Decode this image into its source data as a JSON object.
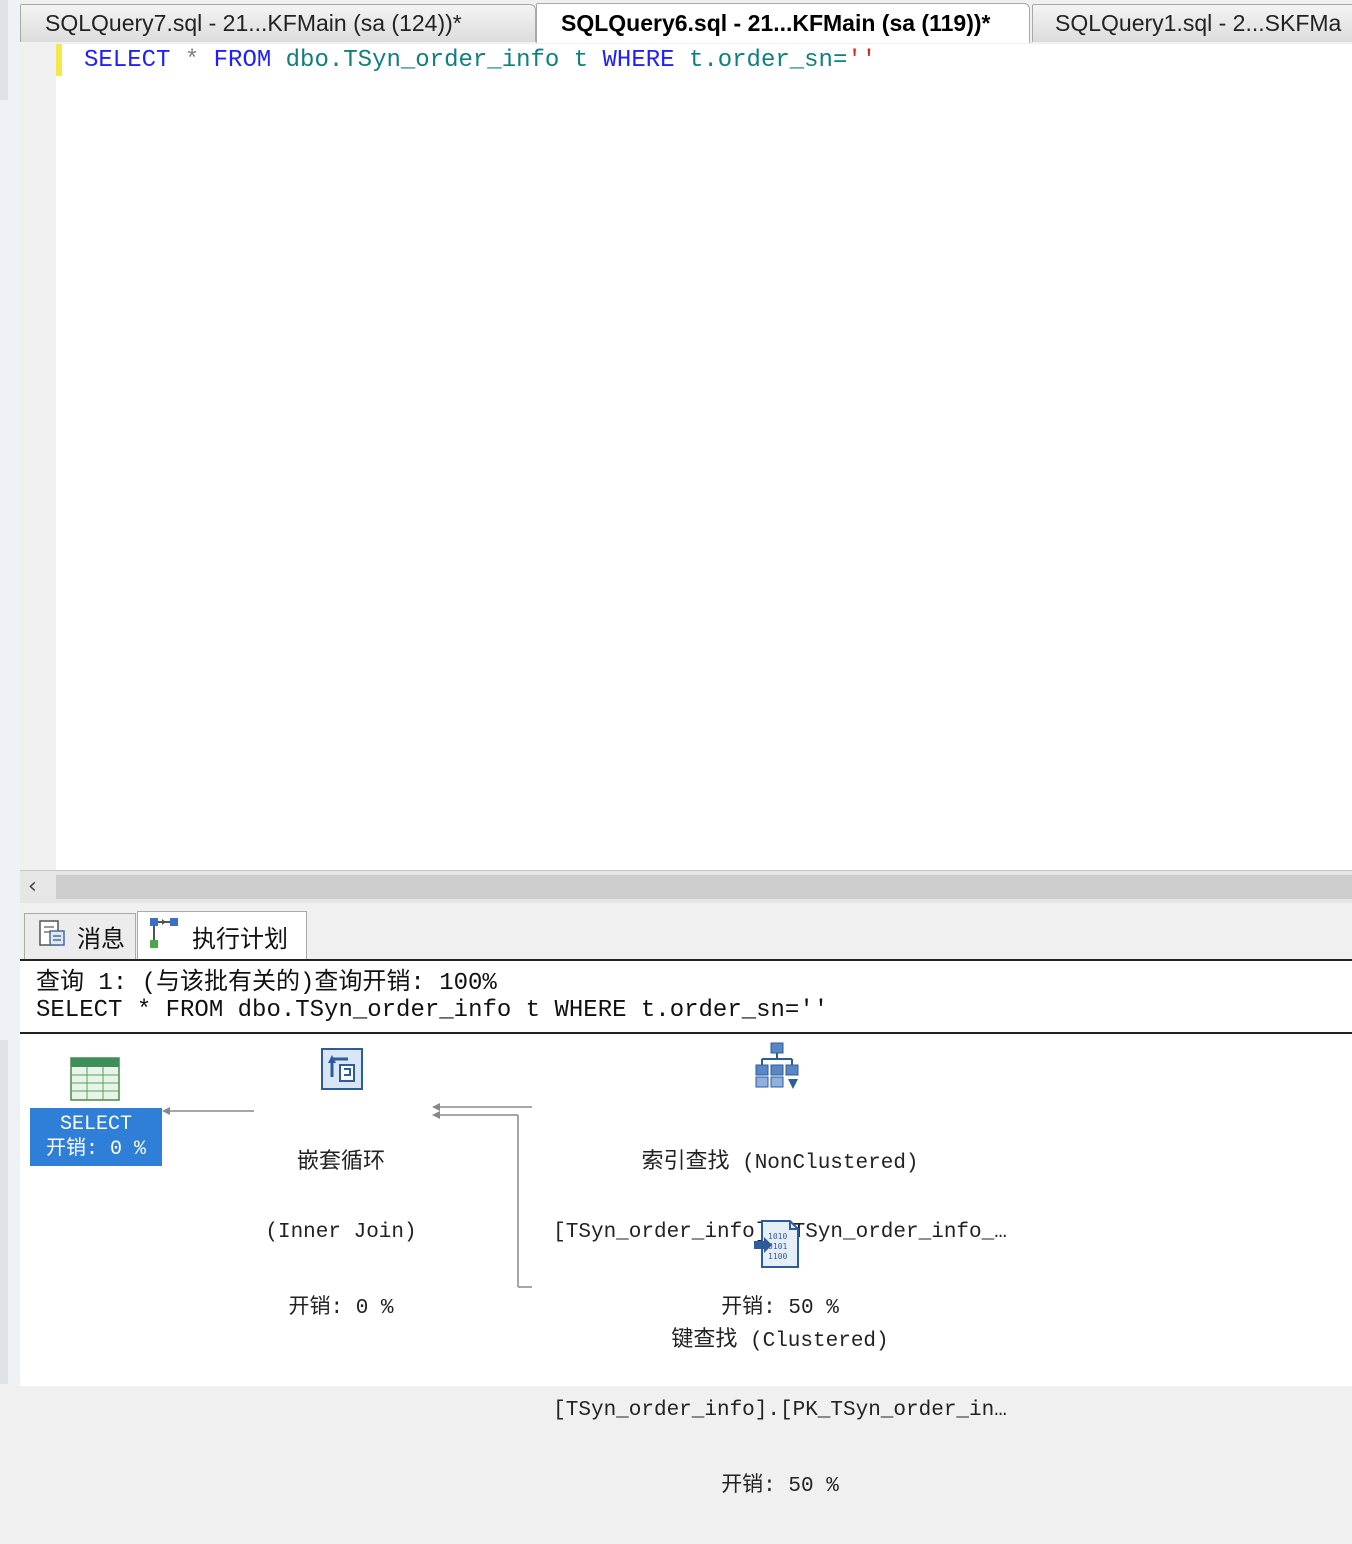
{
  "tabs": [
    {
      "label": "SQLQuery7.sql - 21...KFMain (sa (124))*",
      "active": false
    },
    {
      "label": "SQLQuery6.sql - 21...KFMain (sa (119))*",
      "active": true
    },
    {
      "label": "SQLQuery1.sql - 2...SKFMa",
      "active": false
    }
  ],
  "editor": {
    "code": {
      "select": "SELECT",
      "star": "*",
      "from": "FROM",
      "table": "dbo.TSyn_order_info t",
      "where": "WHERE",
      "column": "t.order_sn=",
      "literal": "''"
    }
  },
  "results_tabs": {
    "messages": "消息",
    "execution_plan": "执行计划"
  },
  "plan": {
    "header": "查询 1: (与该批有关的)查询开销: 100%",
    "query_text": "SELECT * FROM dbo.TSyn_order_info t WHERE t.order_sn=''",
    "nodes": {
      "select": {
        "title": "SELECT",
        "cost": "开销: 0 %"
      },
      "nested_loop": {
        "title": "嵌套循环",
        "subtitle": "(Inner Join)",
        "cost": "开销: 0 %"
      },
      "index_seek": {
        "title": "索引查找",
        "type": "(NonClustered)",
        "object": "[TSyn_order_info].[TSyn_order_info_…",
        "cost": "开销: 50 %"
      },
      "key_lookup": {
        "title": "键查找",
        "type": "(Clustered)",
        "object": "[TSyn_order_info].[PK_TSyn_order_in…",
        "cost": "开销: 50 %"
      }
    }
  },
  "icons": [
    "table-select-icon",
    "nested-loops-icon",
    "index-seek-icon",
    "key-lookup-icon",
    "messages-icon",
    "execution-plan-icon",
    "scroll-left-icon"
  ],
  "colors": {
    "keyword": "#1f1fff",
    "identifier": "#0f8080",
    "string": "#e0241b",
    "selected_node": "#2f7fd8"
  }
}
